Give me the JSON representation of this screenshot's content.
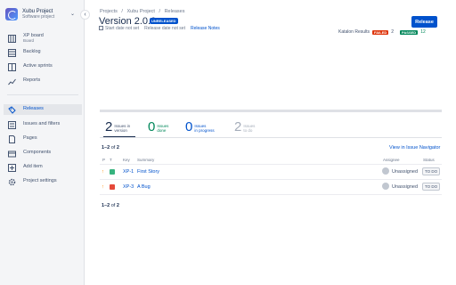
{
  "sidebar": {
    "project_name": "Xubu Project",
    "project_type": "Software project",
    "collapse_glyph": "‹",
    "chevron_glyph": "⌄",
    "items": [
      {
        "label": "XP board",
        "sub": "Board",
        "icon": "board-icon"
      },
      {
        "label": "Backlog",
        "icon": "backlog-icon"
      },
      {
        "label": "Active sprints",
        "icon": "sprints-icon"
      },
      {
        "label": "Reports",
        "icon": "reports-icon"
      },
      {
        "label": "Releases",
        "icon": "releases-icon",
        "active": true
      },
      {
        "label": "Issues and filters",
        "icon": "issues-icon"
      },
      {
        "label": "Pages",
        "icon": "pages-icon"
      },
      {
        "label": "Components",
        "icon": "components-icon"
      },
      {
        "label": "Add item",
        "icon": "add-icon"
      },
      {
        "label": "Project settings",
        "icon": "settings-icon"
      }
    ]
  },
  "breadcrumb": [
    "Projects",
    "Xubu Project",
    "Releases"
  ],
  "breadcrumb_separator": "/",
  "header": {
    "title": "Version 2.0.0",
    "badge": "UNRELEASED",
    "start_date": "Start date not set",
    "release_date": "Release date not set",
    "release_notes": "Release Notes",
    "release_button": "Release"
  },
  "katalon": {
    "label": "Katalon Results",
    "failed_label": "FAILED",
    "failed_count": "2",
    "passed_label": "PASSED",
    "passed_count": "12"
  },
  "stats": [
    {
      "num": "2",
      "l1": "Issues in",
      "l2": "version"
    },
    {
      "num": "0",
      "l1": "Issues",
      "l2": "done"
    },
    {
      "num": "0",
      "l1": "Issues",
      "l2": "in progress"
    },
    {
      "num": "2",
      "l1": "Issues",
      "l2": "to do"
    }
  ],
  "table": {
    "count_prefix": "1–2",
    "count_of": "of",
    "count_total": "2",
    "view_link": "View in Issue Navigator",
    "headers": {
      "p": "P",
      "t": "T",
      "key": "Key",
      "summary": "Summary",
      "assignee": "Assignee",
      "status": "Status"
    },
    "rows": [
      {
        "priority": "↑",
        "type": "story",
        "key": "XP-1",
        "summary": "First Story",
        "assignee": "Unassigned",
        "status": "TO DO"
      },
      {
        "priority": "↑",
        "type": "bug",
        "key": "XP-3",
        "summary": "A Bug",
        "assignee": "Unassigned",
        "status": "TO DO"
      }
    ]
  },
  "colors": {
    "primary": "#0052cc",
    "failed": "#de350b",
    "passed": "#00875a"
  }
}
